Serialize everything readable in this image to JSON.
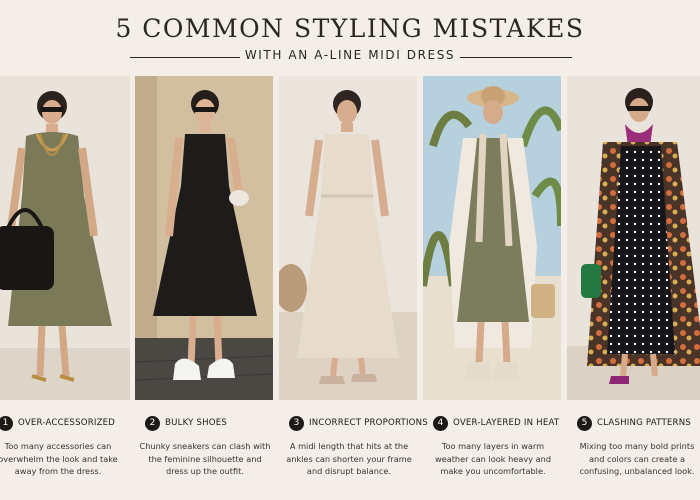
{
  "header": {
    "title": "5 COMMON STYLING MISTAKES",
    "subtitle": "WITH AN A-LINE MIDI DRESS"
  },
  "mistakes": [
    {
      "number": "1",
      "title": "OVER-ACCESSORIZED",
      "description": "Too many accessories can overwhelm the look and take away from the dress.",
      "dress_color": "#7a7a58"
    },
    {
      "number": "2",
      "title": "BULKY SHOES",
      "description": "Chunky sneakers can clash with the feminine silhouette and dress up the outfit.",
      "dress_color": "#1e1c1b"
    },
    {
      "number": "3",
      "title": "INCORRECT PROPORTIONS",
      "description": "A midi length that hits at the ankles can shorten your frame and disrupt balance.",
      "dress_color": "#e7dccb"
    },
    {
      "number": "4",
      "title": "OVER-LAYERED IN HEAT",
      "description": "Too many layers in warm weather can look heavy and make you uncomfortable.",
      "dress_color": "#7b7d5c"
    },
    {
      "number": "5",
      "title": "CLASHING PATTERNS",
      "description": "Mixing too many bold prints and colors can create a confusing, unbalanced look.",
      "dress_color": "#17161b"
    }
  ]
}
